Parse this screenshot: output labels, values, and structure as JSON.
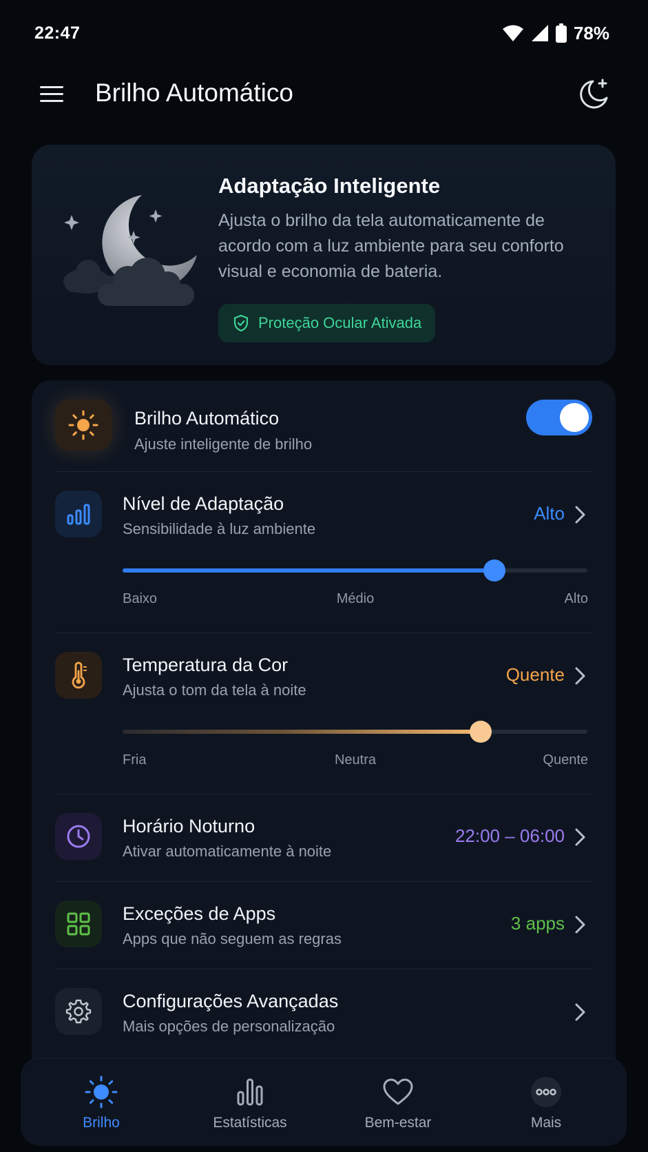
{
  "status_bar": {
    "time": "22:47",
    "battery": "78%"
  },
  "header": {
    "title": "Brilho Automático"
  },
  "hero": {
    "title": "Adaptação Inteligente",
    "description": "Ajusta o brilho da tela automaticamente de acordo com a luz ambiente para seu conforto visual e economia de bateria.",
    "badge": "Proteção Ocular Ativada"
  },
  "settings": {
    "auto_brightness": {
      "title": "Brilho Automático",
      "subtitle": "Ajuste inteligente de brilho",
      "enabled": true
    },
    "adaptation": {
      "title": "Nível de Adaptação",
      "subtitle": "Sensibilidade à luz ambiente",
      "value": "Alto",
      "level": 0.8,
      "labels": [
        "Baixo",
        "Médio",
        "Alto"
      ]
    },
    "color_temp": {
      "title": "Temperatura da Cor",
      "subtitle": "Ajusta o tom da tela à noite",
      "value": "Quente",
      "level": 0.77,
      "labels": [
        "Fria",
        "Neutra",
        "Quente"
      ]
    },
    "night_schedule": {
      "title": "Horário Noturno",
      "subtitle": "Ativar automaticamente à noite",
      "value": "22:00 – 06:00"
    },
    "app_exceptions": {
      "title": "Exceções de Apps",
      "subtitle": "Apps que não seguem as regras",
      "value": "3 apps"
    },
    "advanced": {
      "title": "Configurações Avançadas",
      "subtitle": "Mais opções de personalização"
    }
  },
  "nav": {
    "items": [
      {
        "label": "Brilho",
        "icon": "sun-icon",
        "active": true
      },
      {
        "label": "Estatísticas",
        "icon": "bar-chart-icon",
        "active": false
      },
      {
        "label": "Bem-estar",
        "icon": "heart-icon",
        "active": false
      },
      {
        "label": "Mais",
        "icon": "more-icon",
        "active": false
      }
    ]
  },
  "colors": {
    "accent_blue": "#2f7df3",
    "warm": "#f5a54a",
    "purple": "#9b7bf0",
    "green": "#5ec04a",
    "badge_green": "#3ed69a"
  }
}
